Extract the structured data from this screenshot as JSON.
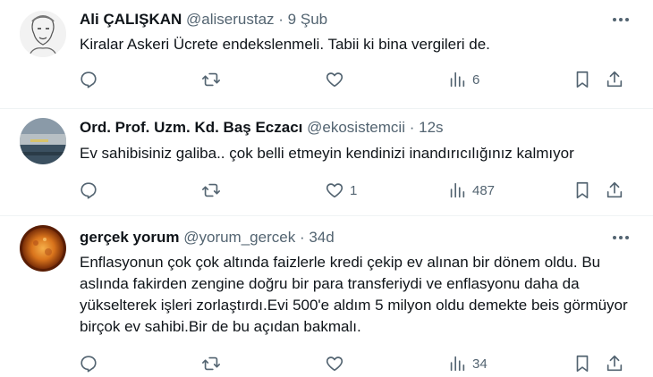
{
  "tweets": [
    {
      "name": "Ali ÇALIŞKAN",
      "handle": "@aliserustaz",
      "dot": "·",
      "time": "9 Şub",
      "text": "Kiralar Askeri Ücrete endekslenmeli. Tabii ki bina vergileri de.",
      "likes": "",
      "views": "6",
      "avatar": "sketch-portrait"
    },
    {
      "name": "Ord. Prof. Uzm. Kd. Baş Eczacı",
      "handle": "@ekosistemcii",
      "dot": "·",
      "time": "12s",
      "text": "Ev sahibisiniz galiba.. çok belli etmeyin kendinizi inandırıcılığınız kalmıyor",
      "likes": "1",
      "views": "487",
      "avatar": "sea-landscape"
    },
    {
      "name": "gerçek yorum",
      "handle": "@yorum_gercek",
      "dot": "·",
      "time": "34d",
      "text": "Enflasyonun çok çok altında faizlerle kredi çekip ev alınan bir dönem oldu. Bu aslında fakirden zengine doğru bir para transferiydi ve enflasyonu daha da yükselterek işleri zorlaştırdı.Evi 500'e aldım 5 milyon oldu demekte beis görmüyor birçok ev sahibi.Bir de bu açıdan bakmalı.",
      "likes": "",
      "views": "34",
      "avatar": "orange-sun"
    }
  ],
  "colors": {
    "text": "#0f1419",
    "muted": "#536471",
    "divider": "#eff3f4"
  }
}
